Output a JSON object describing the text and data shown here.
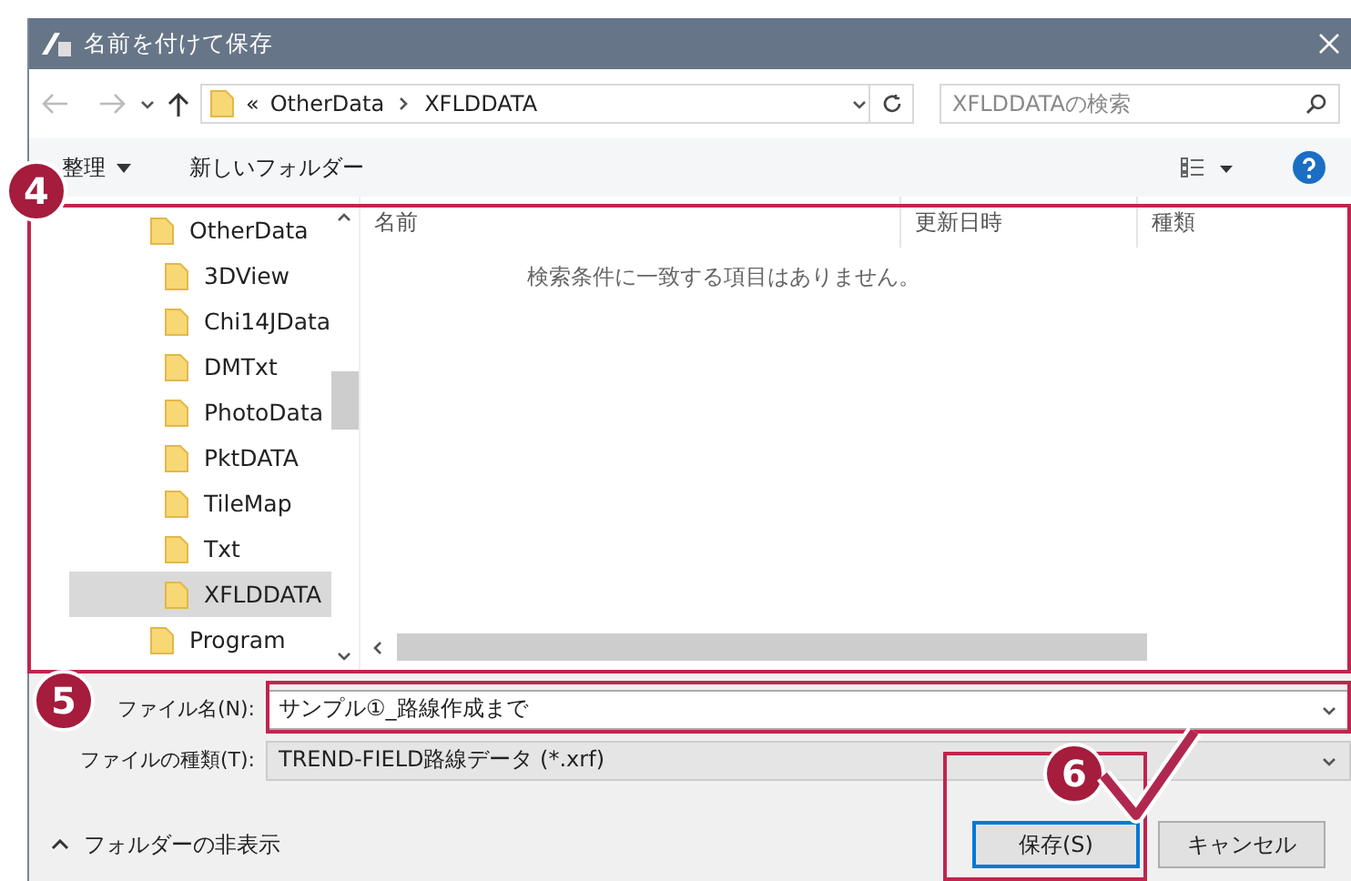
{
  "window": {
    "title": "名前を付けて保存"
  },
  "address": {
    "overflow": "«",
    "crumbs": [
      "OtherData",
      "XFLDDATA"
    ]
  },
  "search": {
    "placeholder": "XFLDDATAの検索"
  },
  "toolbar": {
    "organize": "整理",
    "new_folder": "新しいフォルダー"
  },
  "tree": [
    {
      "label": "OtherData",
      "selected": false,
      "children": [
        {
          "label": "3DView",
          "selected": false
        },
        {
          "label": "Chi14JData",
          "selected": false
        },
        {
          "label": "DMTxt",
          "selected": false
        },
        {
          "label": "PhotoData",
          "selected": false
        },
        {
          "label": "PktDATA",
          "selected": false
        },
        {
          "label": "TileMap",
          "selected": false
        },
        {
          "label": "Txt",
          "selected": false
        },
        {
          "label": "XFLDDATA",
          "selected": true
        }
      ]
    },
    {
      "label": "Program",
      "selected": false
    }
  ],
  "list": {
    "columns": [
      "名前",
      "更新日時",
      "種類"
    ],
    "empty_message": "検索条件に一致する項目はありません。"
  },
  "form": {
    "filename_label": "ファイル名(N):",
    "filename": "サンプル①_路線作成まで",
    "filetype_label": "ファイルの種類(T):",
    "filetype": "TREND-FIELD路線データ (*.xrf)"
  },
  "footer": {
    "hide_folders": "フォルダーの非表示"
  },
  "buttons": [
    {
      "label": "保存(S)",
      "default": true
    },
    {
      "label": "キャンセル",
      "default": false
    }
  ],
  "steps": [
    "4",
    "5",
    "6"
  ]
}
